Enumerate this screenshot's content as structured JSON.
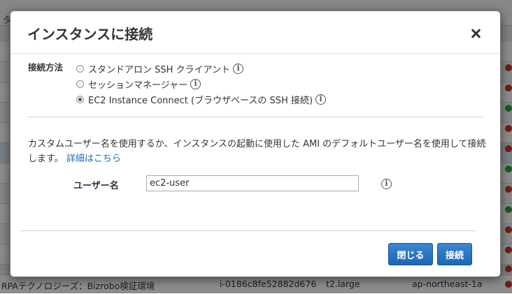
{
  "background": {
    "header_text": "タ",
    "bottom_row": {
      "name": "RPAテクノロジーズ：Bizrobo検証環境",
      "instance_id": "i-0186c8fe52882d676",
      "instance_type": "t2.large",
      "region": "ap-northeast-1a"
    }
  },
  "modal": {
    "title": "インスタンスに接続",
    "connection_method_label": "接続方法",
    "options": [
      {
        "label": "スタンドアロン SSH クライアント",
        "selected": false
      },
      {
        "label": "セッションマネージャー",
        "selected": false
      },
      {
        "label": "EC2 Instance Connect (ブラウザベースの SSH 接続)",
        "selected": true
      }
    ],
    "description": "カスタムユーザー名を使用するか、インスタンスの起動に使用した AMI のデフォルトユーザー名を使用して接続します。",
    "details_link": "詳細はこちら",
    "username_label": "ユーザー名",
    "username_value": "ec2-user",
    "close_button": "閉じる",
    "connect_button": "接続"
  },
  "colors": {
    "primary_button": "#1e67b5",
    "link": "#1a6bbb",
    "status_red": "#c8372a",
    "status_green": "#2ea043"
  }
}
